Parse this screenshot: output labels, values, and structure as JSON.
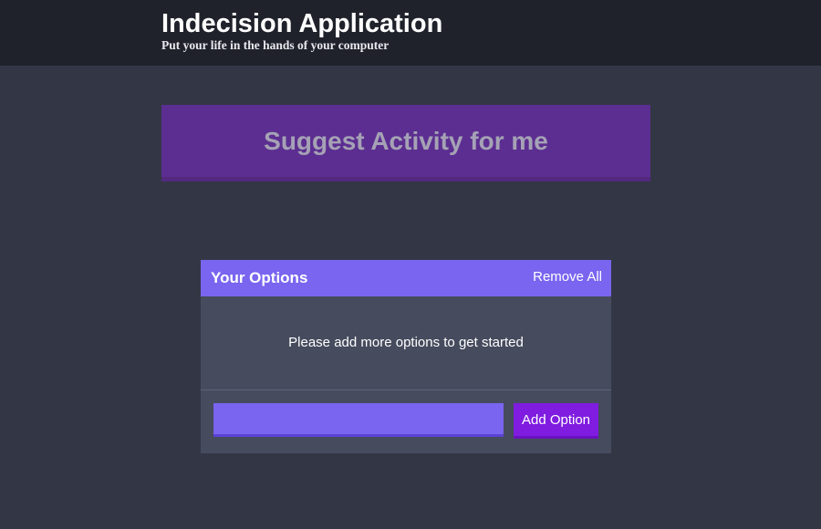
{
  "header": {
    "title": "Indecision Application",
    "subtitle": "Put your life in the hands of your computer"
  },
  "action": {
    "label": "Suggest Activity for me"
  },
  "options": {
    "title": "Your Options",
    "remove_all_label": "Remove All",
    "empty_message": "Please add more options to get started",
    "items": []
  },
  "add_option_form": {
    "input_value": "",
    "input_placeholder": "",
    "button_label": "Add Option"
  },
  "colors": {
    "background": "#333745",
    "header_background": "#20222b",
    "primary_button": "#5c2e91",
    "widget_header": "#7965ef",
    "widget_body": "#464b5e",
    "input_background": "#7965ef",
    "add_button": "#7f1ce0"
  }
}
